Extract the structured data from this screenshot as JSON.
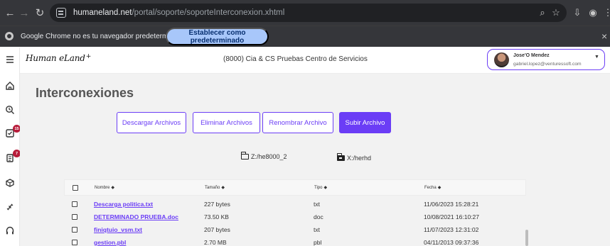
{
  "browser": {
    "url_host": "humaneland.net",
    "url_path": "/portal/soporte/soporteInterconexion.xhtml",
    "icons": [
      "back-icon",
      "forward-icon",
      "reload-icon",
      "zoom-icon",
      "bookmark-icon",
      "downloads-icon",
      "account-icon",
      "menu-icon"
    ]
  },
  "infobar": {
    "message": "Google Chrome no es tu navegador predeterminado",
    "button_label": "Establecer como predeterminado"
  },
  "sidebar": {
    "badges": [
      "15",
      "7"
    ],
    "items": [
      "home-icon",
      "support-icon",
      "tasks-icon",
      "documents-icon",
      "box-icon",
      "connections-icon",
      "headset-icon"
    ]
  },
  "header": {
    "company": "(8000) Cia & CS Pruebas Centro de Servicios",
    "user_name": "Jose'O Mendez",
    "user_email": "gabriel.lopez@venturessoft.com"
  },
  "page": {
    "title": "Interconexiones",
    "buttons": {
      "download": "Descargar Archivos",
      "delete": "Eliminar Archivos",
      "rename": "Renombrar Archivo",
      "upload": "Subir Archivo"
    },
    "drives": {
      "left": "Z:/he8000_2",
      "right": "X:/herhd"
    },
    "table": {
      "headers": {
        "name": "Nombre",
        "size": "Tamaño",
        "type": "Tipo",
        "date": "Fecha"
      },
      "rows": [
        {
          "name": "Descarga politica.txt",
          "size": "227 bytes",
          "type": "txt",
          "date": "11/06/2023 15:28:21"
        },
        {
          "name": "DETERMINADO PRUEBA.doc",
          "size": "73.50 KB",
          "type": "doc",
          "date": "10/08/2021 16:10:27"
        },
        {
          "name": "finiqtuio_vsm.txt",
          "size": "207 bytes",
          "type": "txt",
          "date": "11/07/2023 12:31:02"
        },
        {
          "name": "gestion.pbl",
          "size": "2.70 MB",
          "type": "pbl",
          "date": "04/11/2013 09:37:36"
        }
      ]
    }
  },
  "colors": {
    "accent": "#6B3DF6",
    "browser_dark": "#35363A",
    "main_background": "#F2F2F2",
    "badge": "#B71C3A"
  }
}
